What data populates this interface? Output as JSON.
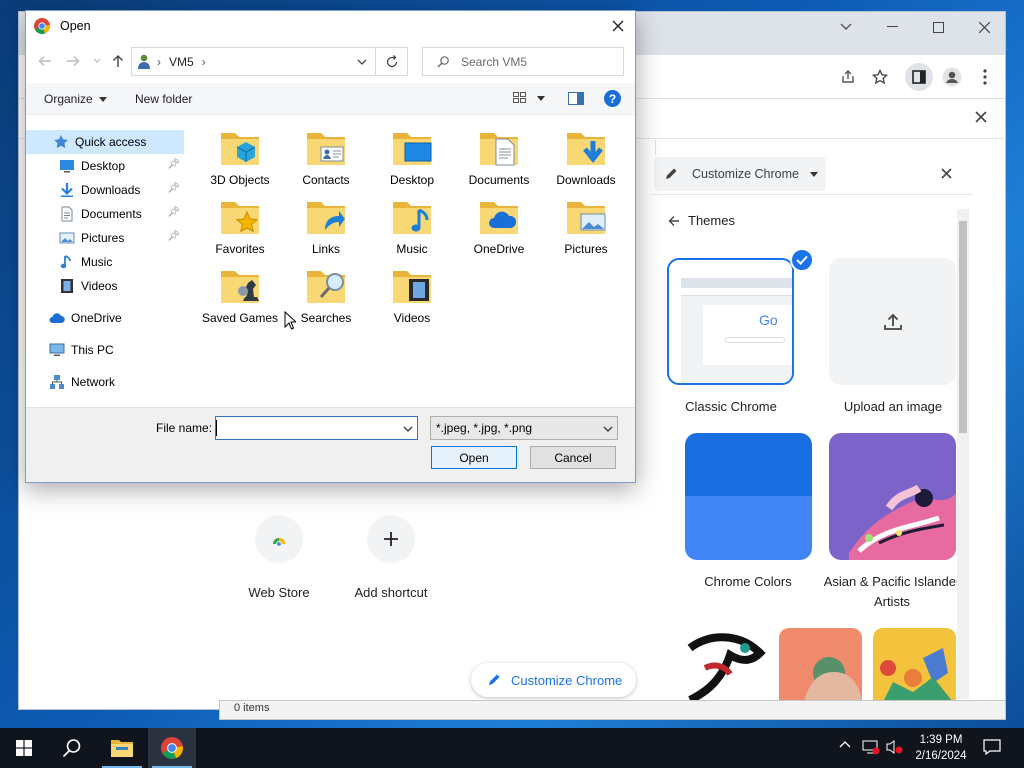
{
  "dialog": {
    "title": "Open",
    "path_segments": [
      "VM5"
    ],
    "search_placeholder": "Search VM5",
    "organize_label": "Organize",
    "new_folder_label": "New folder",
    "nav_pane": {
      "quick_access": "Quick access",
      "quick_items": [
        {
          "label": "Desktop",
          "pinned": true
        },
        {
          "label": "Downloads",
          "pinned": true
        },
        {
          "label": "Documents",
          "pinned": true
        },
        {
          "label": "Pictures",
          "pinned": true
        },
        {
          "label": "Music",
          "pinned": false
        },
        {
          "label": "Videos",
          "pinned": false
        }
      ],
      "onedrive": "OneDrive",
      "this_pc": "This PC",
      "network": "Network"
    },
    "files": [
      {
        "label": "3D Objects",
        "icon": "3d-objects-folder-icon"
      },
      {
        "label": "Contacts",
        "icon": "contacts-folder-icon"
      },
      {
        "label": "Desktop",
        "icon": "desktop-folder-icon"
      },
      {
        "label": "Documents",
        "icon": "documents-folder-icon"
      },
      {
        "label": "Downloads",
        "icon": "downloads-folder-icon"
      },
      {
        "label": "Favorites",
        "icon": "favorites-folder-icon"
      },
      {
        "label": "Links",
        "icon": "links-folder-icon"
      },
      {
        "label": "Music",
        "icon": "music-folder-icon"
      },
      {
        "label": "OneDrive",
        "icon": "onedrive-folder-icon"
      },
      {
        "label": "Pictures",
        "icon": "pictures-folder-icon"
      },
      {
        "label": "Saved Games",
        "icon": "saved-games-folder-icon"
      },
      {
        "label": "Searches",
        "icon": "searches-folder-icon"
      },
      {
        "label": "Videos",
        "icon": "videos-folder-icon"
      }
    ],
    "file_name_label": "File name:",
    "file_name_value": "",
    "file_type_value": "*.jpeg, *.jpg, *.png",
    "open_label": "Open",
    "cancel_label": "Cancel"
  },
  "chrome": {
    "customize_title": "Customize Chrome",
    "themes_label": "Themes",
    "themes": [
      {
        "label": "Classic Chrome",
        "selected": true
      },
      {
        "label": "Upload an image",
        "selected": false
      },
      {
        "label": "Chrome Colors",
        "selected": false
      },
      {
        "label": "Asian & Pacific Islander Artists",
        "selected": false
      }
    ],
    "ntp_tiles": [
      {
        "label": "Web Store"
      },
      {
        "label": "Add shortcut"
      }
    ],
    "customize_button": "Customize Chrome",
    "explorer_status": "0 items",
    "accent_color": "#1a73e8"
  },
  "taskbar": {
    "time": "1:39 PM",
    "date": "2/16/2024"
  }
}
